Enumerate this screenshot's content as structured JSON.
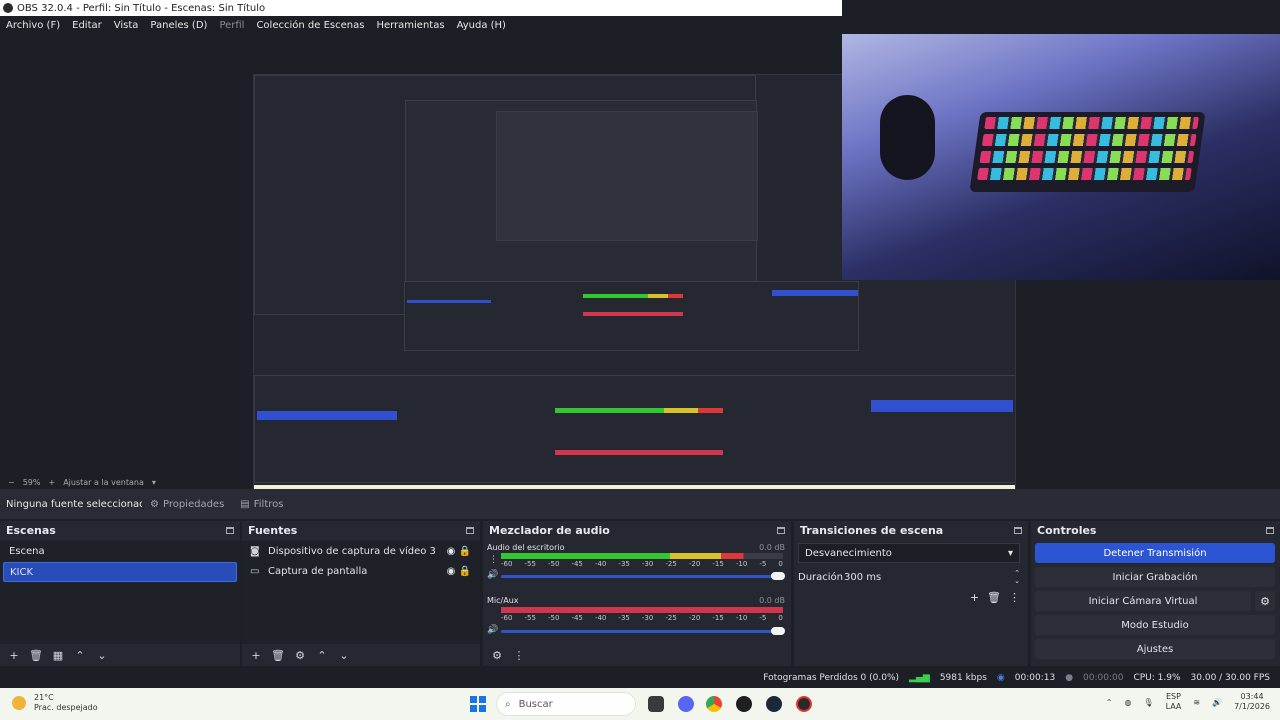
{
  "window": {
    "title": "OBS 32.0.4 - Perfil: Sin Título - Escenas: Sin Título"
  },
  "menu": [
    {
      "label": "Archivo (F)"
    },
    {
      "label": "Editar"
    },
    {
      "label": "Vista"
    },
    {
      "label": "Paneles (D)"
    },
    {
      "label": "Perfil",
      "dim": true
    },
    {
      "label": "Colección de Escenas"
    },
    {
      "label": "Herramientas"
    },
    {
      "label": "Ayuda (H)"
    }
  ],
  "zoom": {
    "value": "59%",
    "fit_label": "Ajustar a la ventana"
  },
  "source_toolbar": {
    "no_source": "Ninguna fuente seleccionada",
    "properties": "Propiedades",
    "filters": "Filtros"
  },
  "scenes": {
    "title": "Escenas",
    "items": [
      {
        "label": "Escena"
      },
      {
        "label": "KICK",
        "selected": true
      }
    ]
  },
  "sources": {
    "title": "Fuentes",
    "items": [
      {
        "label": "Dispositivo de captura de vídeo 3",
        "icon": "camera-icon"
      },
      {
        "label": "Captura de pantalla",
        "icon": "monitor-icon"
      }
    ]
  },
  "mixer": {
    "title": "Mezclador de audio",
    "channels": [
      {
        "name": "Audio del escritorio",
        "db": "0.0 dB",
        "level": 0.86
      },
      {
        "name": "Mic/Aux",
        "db": "0.0 dB",
        "level": 0.0
      }
    ],
    "ticks": [
      "-60",
      "-55",
      "-50",
      "-45",
      "-40",
      "-35",
      "-30",
      "-25",
      "-20",
      "-15",
      "-10",
      "-5",
      "0"
    ]
  },
  "transitions": {
    "title": "Transiciones de escena",
    "selected": "Desvanecimiento",
    "duration_label": "Duración",
    "duration_value": "300 ms"
  },
  "controls": {
    "title": "Controles",
    "buttons": {
      "stop_stream": "Detener Transmisión",
      "start_record": "Iniciar Grabación",
      "virtual_cam": "Iniciar Cámara Virtual",
      "studio_mode": "Modo Estudio",
      "settings": "Ajustes"
    }
  },
  "status": {
    "dropped_frames": "Fotogramas Perdidos 0 (0.0%)",
    "bitrate": "5981 kbps",
    "stream_time": "00:00:13",
    "rec_time": "00:00:00",
    "cpu": "CPU: 1.9%",
    "fps": "30.00 / 30.00 FPS"
  },
  "taskbar": {
    "weather_temp": "21°C",
    "weather_desc": "Prac. despejado",
    "search_placeholder": "Buscar",
    "lang_top": "ESP",
    "lang_bottom": "LAA",
    "time": "03:44",
    "date": "7/1/2026"
  },
  "colors": {
    "accent": "#2c55d3",
    "meter_green": "#32c832",
    "meter_red": "#d2364f"
  }
}
